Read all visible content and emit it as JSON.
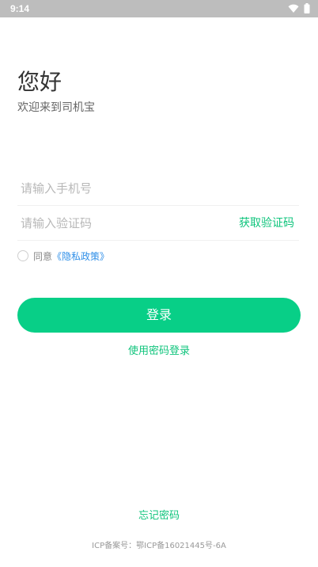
{
  "status_bar": {
    "time": "9:14",
    "icons": [
      "wifi-icon",
      "battery-icon"
    ]
  },
  "header": {
    "title": "您好",
    "subtitle": "欢迎来到司机宝"
  },
  "form": {
    "phone_placeholder": "请输入手机号",
    "code_placeholder": "请输入验证码",
    "get_code_label": "获取验证码"
  },
  "agreement": {
    "prefix": "同意",
    "policy_link": "《隐私政策》"
  },
  "actions": {
    "login_label": "登录",
    "password_login_label": "使用密码登录",
    "forgot_password_label": "忘记密码"
  },
  "footer": {
    "icp": "ICP备案号：鄂ICP备16021445号-6A"
  },
  "colors": {
    "accent": "#08cf87",
    "link_blue": "#2f8fe8",
    "status_bar": "#bdbdbd"
  }
}
